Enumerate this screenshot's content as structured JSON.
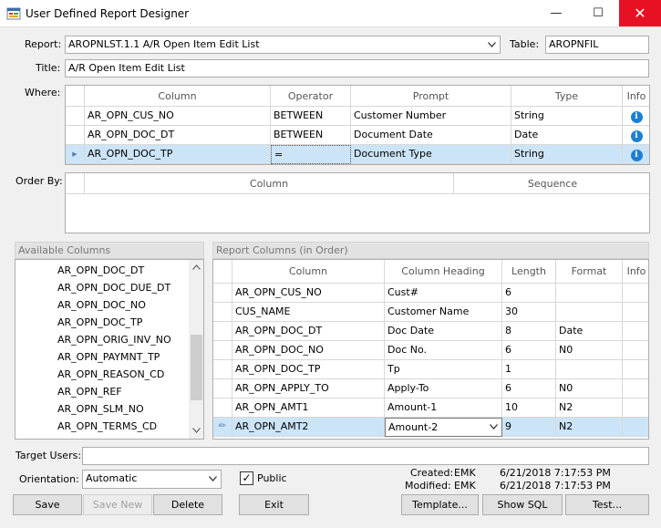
{
  "window": {
    "title": "User Defined Report Designer",
    "minimize": "—",
    "maximize": "☐",
    "close": "✕"
  },
  "report": {
    "label": "Report:",
    "value": "AROPNLST.1.1  A/R Open Item Edit List"
  },
  "table": {
    "label": "Table:",
    "value": "AROPNFIL"
  },
  "title_field": {
    "label": "Title:",
    "value": "A/R Open Item Edit List"
  },
  "where": {
    "label": "Where:",
    "headers": [
      "Column",
      "Operator",
      "Prompt",
      "Type",
      "Info"
    ],
    "rows": [
      {
        "column": "AR_OPN_CUS_NO",
        "operator": "BETWEEN",
        "prompt": "Customer Number",
        "type": "String",
        "info": "i"
      },
      {
        "column": "AR_OPN_DOC_DT",
        "operator": "BETWEEN",
        "prompt": "Document Date",
        "type": "Date",
        "info": "i"
      },
      {
        "column": "AR_OPN_DOC_TP",
        "operator": "=",
        "prompt": "Document Type",
        "type": "String",
        "info": "i"
      }
    ],
    "current_marker": "▶"
  },
  "order_by": {
    "label": "Order By:",
    "headers": [
      "Column",
      "Sequence"
    ]
  },
  "available": {
    "header": "Available Columns",
    "items": [
      "AR_OPN_DOC_DT",
      "AR_OPN_DOC_DUE_DT",
      "AR_OPN_DOC_NO",
      "AR_OPN_DOC_TP",
      "AR_OPN_ORIG_INV_NO",
      "AR_OPN_PAYMNT_TP",
      "AR_OPN_REASON_CD",
      "AR_OPN_REF",
      "AR_OPN_SLM_NO",
      "AR_OPN_TERMS_CD"
    ]
  },
  "report_columns": {
    "header": "Report Columns (in Order)",
    "headers": [
      "Column",
      "Column Heading",
      "Length",
      "Format",
      "Info"
    ],
    "rows": [
      {
        "column": "AR_OPN_CUS_NO",
        "heading": "Cust#",
        "length": "6",
        "format": ""
      },
      {
        "column": "CUS_NAME",
        "heading": "Customer Name",
        "length": "30",
        "format": ""
      },
      {
        "column": "AR_OPN_DOC_DT",
        "heading": "Doc Date",
        "length": "8",
        "format": "Date"
      },
      {
        "column": "AR_OPN_DOC_NO",
        "heading": "Doc No.",
        "length": "6",
        "format": "N0"
      },
      {
        "column": "AR_OPN_DOC_TP",
        "heading": "Tp",
        "length": "1",
        "format": ""
      },
      {
        "column": "AR_OPN_APPLY_TO",
        "heading": "Apply-To",
        "length": "6",
        "format": "N0"
      },
      {
        "column": "AR_OPN_AMT1",
        "heading": "Amount-1",
        "length": "10",
        "format": "N2"
      },
      {
        "column": "AR_OPN_AMT2",
        "heading": "Amount-2",
        "length": "9",
        "format": "N2"
      }
    ],
    "edit_marker": "✏"
  },
  "target_users": {
    "label": "Target Users:",
    "value": ""
  },
  "orientation": {
    "label": "Orientation:",
    "value": "Automatic"
  },
  "public": {
    "label": "Public",
    "checked": true,
    "check": "✓"
  },
  "created": {
    "label": "Created:",
    "user": "EMK",
    "date": "6/21/2018 7:17:53 PM"
  },
  "modified": {
    "label": "Modified:",
    "user": "EMK",
    "date": "6/21/2018 7:17:53 PM"
  },
  "buttons": {
    "save": "Save",
    "save_new": "Save New",
    "delete": "Delete",
    "exit": "Exit",
    "template": "Template...",
    "show_sql": "Show SQL",
    "test": "Test..."
  },
  "colors": {
    "selection": "#cce4f7",
    "info": "#1d7fd3",
    "close": "#e81123"
  }
}
